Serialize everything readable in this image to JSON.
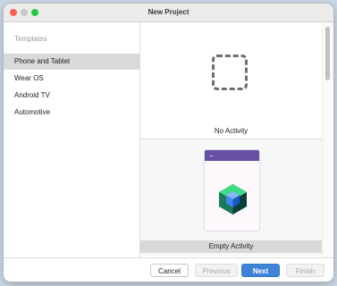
{
  "window": {
    "title": "New Project"
  },
  "sidebar": {
    "header": "Templates",
    "items": [
      {
        "label": "Phone and Tablet",
        "selected": true
      },
      {
        "label": "Wear OS",
        "selected": false
      },
      {
        "label": "Android TV",
        "selected": false
      },
      {
        "label": "Automotive",
        "selected": false
      }
    ]
  },
  "templates": [
    {
      "label": "No Activity",
      "icon": "dashed-square-icon"
    },
    {
      "label": "Empty Activity",
      "icon": "compose-logo-icon",
      "selected": true
    }
  ],
  "footer": {
    "cancel": "Cancel",
    "previous": "Previous",
    "next": "Next",
    "finish": "Finish"
  },
  "colors": {
    "accent": "#3d84d8",
    "app_bar": "#6650a4",
    "selected_bg": "#d9d9d9"
  }
}
